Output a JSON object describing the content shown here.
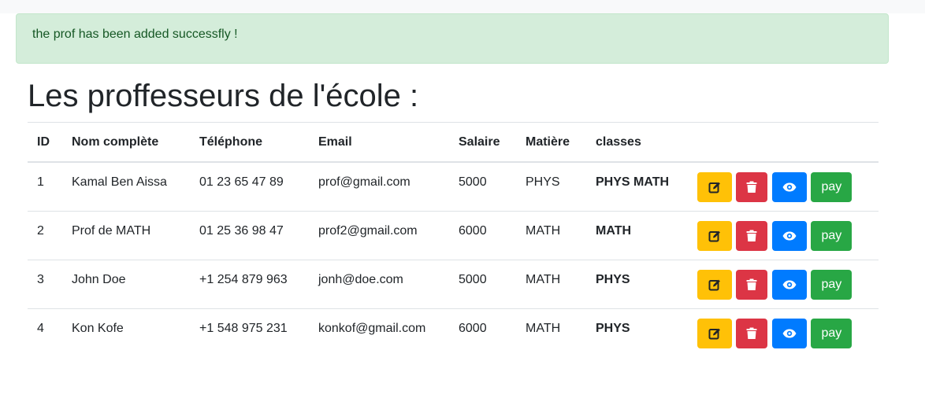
{
  "alert": {
    "message": "the prof has been added successfly !"
  },
  "page": {
    "title": "Les proffesseurs de l'école :"
  },
  "table": {
    "headers": {
      "id": "ID",
      "name": "Nom complète",
      "phone": "Téléphone",
      "email": "Email",
      "salary": "Salaire",
      "subject": "Matière",
      "classes": "classes"
    },
    "rows": [
      {
        "id": "1",
        "name": "Kamal Ben Aissa",
        "phone": "01 23 65 47 89",
        "email": "prof@gmail.com",
        "salary": "5000",
        "subject": "PHYS",
        "classes": "PHYS MATH"
      },
      {
        "id": "2",
        "name": "Prof de MATH",
        "phone": "01 25 36 98 47",
        "email": "prof2@gmail.com",
        "salary": "6000",
        "subject": "MATH",
        "classes": "MATH"
      },
      {
        "id": "3",
        "name": "John Doe",
        "phone": "+1 254 879 963",
        "email": "jonh@doe.com",
        "salary": "5000",
        "subject": "MATH",
        "classes": "PHYS"
      },
      {
        "id": "4",
        "name": "Kon Kofe",
        "phone": "+1 548 975 231",
        "email": "konkof@gmail.com",
        "salary": "6000",
        "subject": "MATH",
        "classes": "PHYS"
      }
    ]
  },
  "actions": {
    "edit_icon": "edit-icon",
    "delete_icon": "trash-icon",
    "view_icon": "eye-icon",
    "pay_label": "pay"
  },
  "colors": {
    "alert_bg": "#d4edda",
    "alert_text": "#155724",
    "edit": "#ffc107",
    "delete": "#dc3545",
    "view": "#007bff",
    "pay": "#28a745"
  }
}
